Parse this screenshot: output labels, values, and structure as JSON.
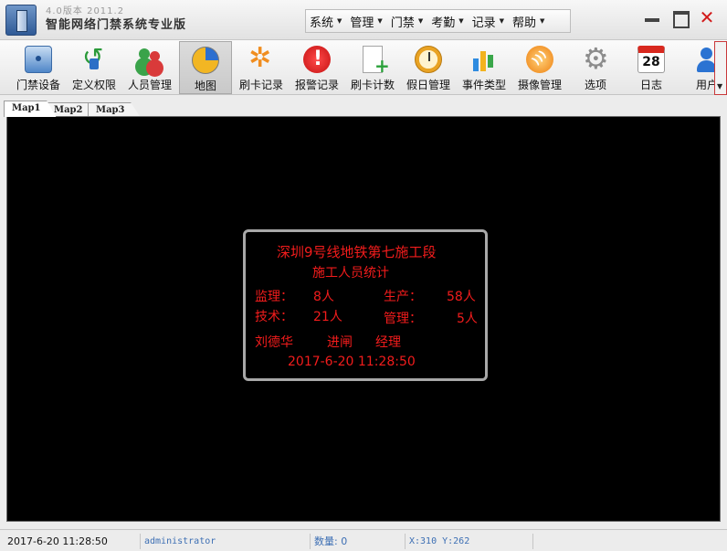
{
  "window": {
    "version": "4.0版本 2011.2",
    "title": "智能网络门禁系统专业版",
    "close_glyph": "✕"
  },
  "menu": [
    {
      "label": "系统",
      "icon": "caret-down-icon"
    },
    {
      "label": "管理",
      "icon": "caret-down-icon"
    },
    {
      "label": "门禁",
      "icon": "caret-down-icon"
    },
    {
      "label": "考勤",
      "icon": "caret-down-icon"
    },
    {
      "label": "记录",
      "icon": "caret-down-icon"
    },
    {
      "label": "帮助",
      "icon": "caret-down-icon"
    }
  ],
  "toolbar": [
    {
      "label": "门禁设备",
      "icon": "access-device-icon"
    },
    {
      "label": "定义权限",
      "icon": "permission-icon"
    },
    {
      "label": "人员管理",
      "icon": "people-icon"
    },
    {
      "label": "地图",
      "icon": "map-icon",
      "active": true
    },
    {
      "label": "刷卡记录",
      "icon": "card-log-icon"
    },
    {
      "label": "报警记录",
      "icon": "alarm-icon"
    },
    {
      "label": "刷卡计数",
      "icon": "card-count-icon"
    },
    {
      "label": "假日管理",
      "icon": "holiday-clock-icon"
    },
    {
      "label": "事件类型",
      "icon": "event-chart-icon"
    },
    {
      "label": "摄像管理",
      "icon": "camera-icon"
    },
    {
      "label": "选项",
      "icon": "gear-icon"
    },
    {
      "label": "日志",
      "icon": "calendar-icon",
      "icon_text": "28"
    },
    {
      "label": "用户",
      "icon": "user-icon"
    }
  ],
  "tabs": [
    {
      "label": "Map1",
      "active": true
    },
    {
      "label": "Map2"
    },
    {
      "label": "Map3"
    }
  ],
  "panel": {
    "line1": "深圳9号线地铁第七施工段",
    "line2": "施工人员统计",
    "supervise_label": "监理：",
    "supervise_value": "8人",
    "production_label": "生产：",
    "production_value": "58人",
    "tech_label": "技术：",
    "tech_value": "21人",
    "management_label": "管理：",
    "management_value": "5人",
    "person_name": "刘德华",
    "person_action": "进闸",
    "person_role": "经理",
    "timestamp": "2017-6-20 11:28:50"
  },
  "status": {
    "time": "2017-6-20 11:28:50",
    "user": "administrator",
    "count": "数量: 0",
    "coords": "X:310 Y:262"
  },
  "colors": {
    "panel_text": "#f21c1c",
    "close_button": "#d21a1a",
    "status_link": "#3d6fb4"
  }
}
